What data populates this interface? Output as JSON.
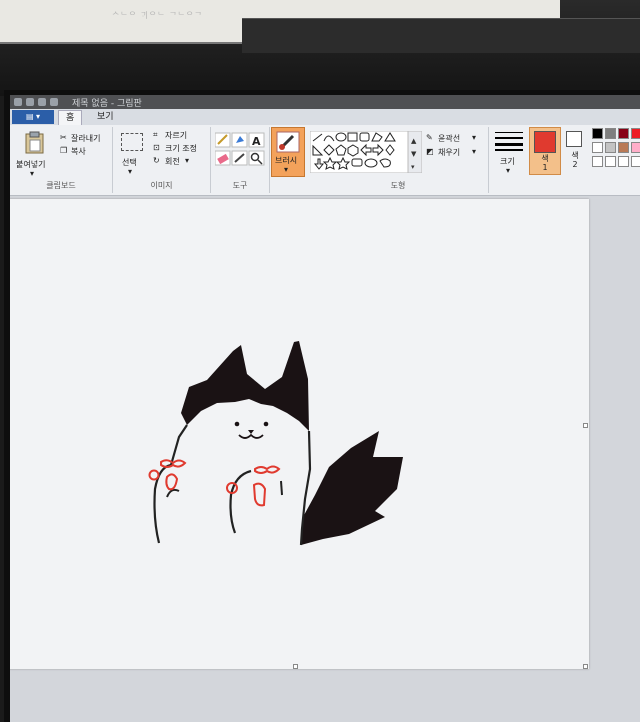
{
  "background_window": {
    "text": "ᄉᄂᄋ ᄀᆡᄋᄂ ᄀᄂᄋᄀ"
  },
  "titlebar": {
    "title": "제목 없음 - 그림판"
  },
  "tabs": [
    {
      "label": "홈"
    },
    {
      "label": "보기"
    }
  ],
  "ribbon": {
    "clipboard": {
      "paste": "붙여넣기",
      "cut": "잘라내기",
      "copy": "복사",
      "group_label": "클립보드"
    },
    "image": {
      "select": "선택",
      "crop": "자르기",
      "resize": "크기 조정",
      "rotate": "회전",
      "group_label": "이미지"
    },
    "tools": {
      "group_label": "도구"
    },
    "brush": {
      "label": "브러시"
    },
    "shapes": {
      "outline": "윤곽선",
      "fill": "채우기",
      "group_label": "도형"
    },
    "size": {
      "label": "크기"
    },
    "color1": {
      "label": "색 1",
      "value": "#e03a2f"
    },
    "color2": {
      "label": "색 2",
      "value": "#ffffff"
    },
    "palette": [
      "#000000",
      "#7f7f7f",
      "#880015",
      "#ed1c24",
      "#ffffff",
      "#c3c3c3",
      "#b97a57",
      "#ffaec9",
      "#ffffff",
      "#ffffff",
      "#ffffff",
      "#ffffff"
    ]
  },
  "colors": {
    "accent_orange": "#f3a25b",
    "file_menu": "#2b5ea8"
  }
}
